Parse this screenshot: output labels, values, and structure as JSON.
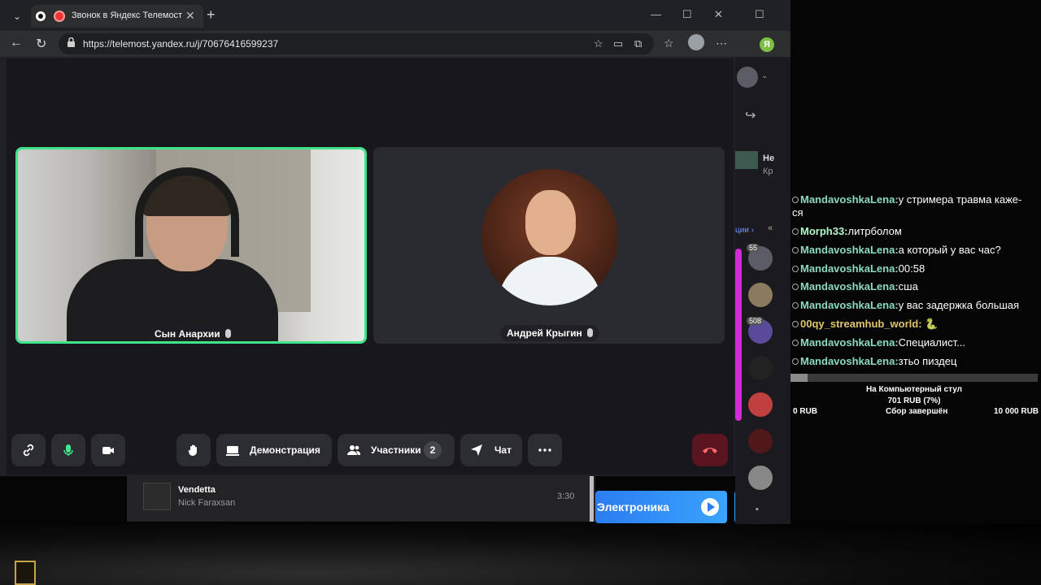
{
  "browser": {
    "tab_title": "Звонок в Яндекс Телемосте",
    "url": "https://telemost.yandex.ru/j/70676416599237"
  },
  "call": {
    "participants": [
      {
        "name": "Сын Анархии",
        "speaking": true
      },
      {
        "name": "Андрей Крыгин",
        "speaking": false
      }
    ],
    "controls": {
      "screen_share_label": "Демонстрация",
      "participants_label": "Участники",
      "participants_count": "2",
      "chat_label": "Чат"
    }
  },
  "music": {
    "title": "Vendetta",
    "artist": "Nick Faraxsan",
    "duration": "3:30",
    "promo_label": "Электроника"
  },
  "sidebar": {
    "item_title": "Не",
    "item_sub": "Кр",
    "section_label": "ции",
    "badges": [
      "55",
      "508"
    ]
  },
  "chat": {
    "messages": [
      {
        "user": "MandavoshkaLena:",
        "text": "у стримера травма каже-"
      },
      {
        "user": "",
        "text": "ся"
      },
      {
        "user": "Morph33:",
        "text": "литрболом"
      },
      {
        "user": "MandavoshkaLena:",
        "text": "а который у вас час?"
      },
      {
        "user": "MandavoshkaLena:",
        "text": "00:58"
      },
      {
        "user": "MandavoshkaLena:",
        "text": "сша"
      },
      {
        "user": "MandavoshkaLena:",
        "text": "у вас задержка большая"
      },
      {
        "user": "00qy_streamhub_world:",
        "text": "🐍"
      },
      {
        "user": "MandavoshkaLena:",
        "text": "Специалист..."
      },
      {
        "user": "MandavoshkaLena:",
        "text": "зтьо пиздец"
      }
    ]
  },
  "donation_goal": {
    "title": "На Компьютерный стул",
    "amount": "701 RUB (7%)",
    "progress": 0.07,
    "min": "0 RUB",
    "status": "Сбор завершён",
    "max": "10 000 RUB"
  },
  "colors": {
    "speaking_border": "#3fe58a",
    "end_call": "#5b1520",
    "chat_username": "#8cd9c4"
  }
}
